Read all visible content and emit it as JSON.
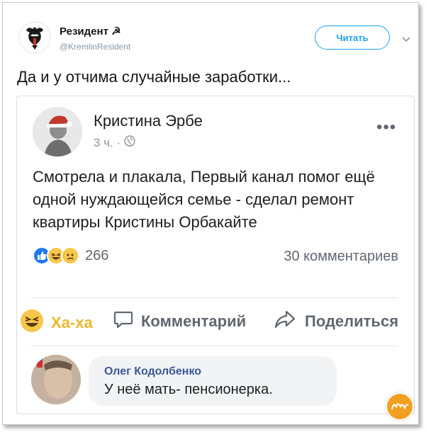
{
  "tweet": {
    "author_name": "Резидент ☭",
    "author_handle": "@KremlinResident",
    "follow_label": "Читать",
    "text": "Да и у отчима случайные заработки..."
  },
  "fb_post": {
    "author_name": "Кристина Эрбе",
    "time": "3 ч. ·",
    "body": "Смотрела и плакала, Первый канал помог ещё одной нуждающейся семье - сделал ремонт квартиры Кристины Орбакайте",
    "reaction_count": "266",
    "comments_count": "30 комментариев",
    "actions": {
      "haha": "Ха-ха",
      "comment": "Комментарий",
      "share": "Поделиться"
    },
    "comment": {
      "author": "Олег Кодолбенко",
      "text": "У неё мать- пенсионерка."
    }
  },
  "icons": [
    "kremlin-avatar-icon",
    "chevron-down-icon",
    "globe-icon",
    "like-reaction-icon",
    "haha-reaction-icon",
    "sad-reaction-icon",
    "comment-icon",
    "share-icon",
    "watermark-logo-icon"
  ],
  "colors": {
    "twitter_blue": "#1da1f2",
    "fb_link": "#385898",
    "haha_yellow": "#f0b72a",
    "like_blue": "#2078f4"
  }
}
